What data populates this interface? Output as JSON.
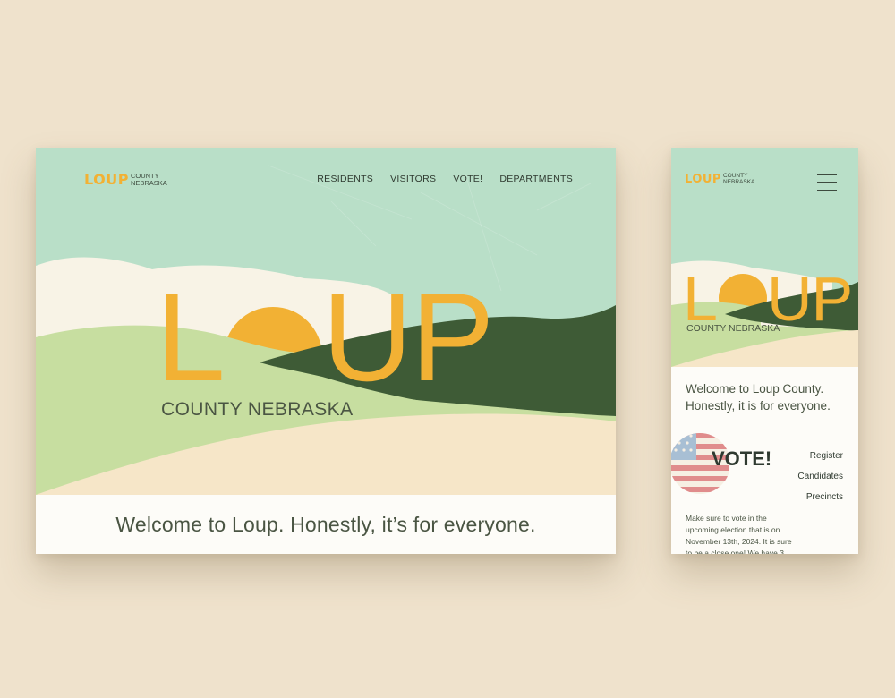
{
  "desktop": {
    "logo": {
      "mark": "LOUP",
      "sub_line1": "COUNTY",
      "sub_line2": "NEBRASKA"
    },
    "nav": [
      "RESIDENTS",
      "VISITORS",
      "VOTE!",
      "DEPARTMENTS"
    ],
    "hero": {
      "letter_l": "L",
      "letters_up": "UP",
      "subtitle": "COUNTY NEBRASKA"
    },
    "welcome": "Welcome to Loup. Honestly, it’s for everyone."
  },
  "mobile": {
    "logo": {
      "mark": "LOUP",
      "sub_line1": "COUNTY",
      "sub_line2": "NEBRASKA"
    },
    "menu_icon": "hamburger-menu-icon",
    "hero": {
      "letter_l": "L",
      "letters_up": "UP",
      "subtitle": "COUNTY NEBRASKA"
    },
    "welcome": "Welcome to Loup County. Honestly, it is for everyone.",
    "vote_heading": "VOTE!",
    "vote_links": [
      "Register",
      "Candidates",
      "Precincts"
    ],
    "paragraph": "Make sure to vote in the upcoming election that is on November 13th, 2024. It is sure to be a close one! We have 3"
  },
  "colors": {
    "background": "#efe2cc",
    "sky": "#b9dfc8",
    "sun_accent": "#f2b134",
    "dark_hill": "#3e5b36",
    "light_hill": "#c7dea0",
    "sand": "#f6e6c8",
    "cloud": "#f8f3e6",
    "text_dark": "#2f3a30"
  }
}
